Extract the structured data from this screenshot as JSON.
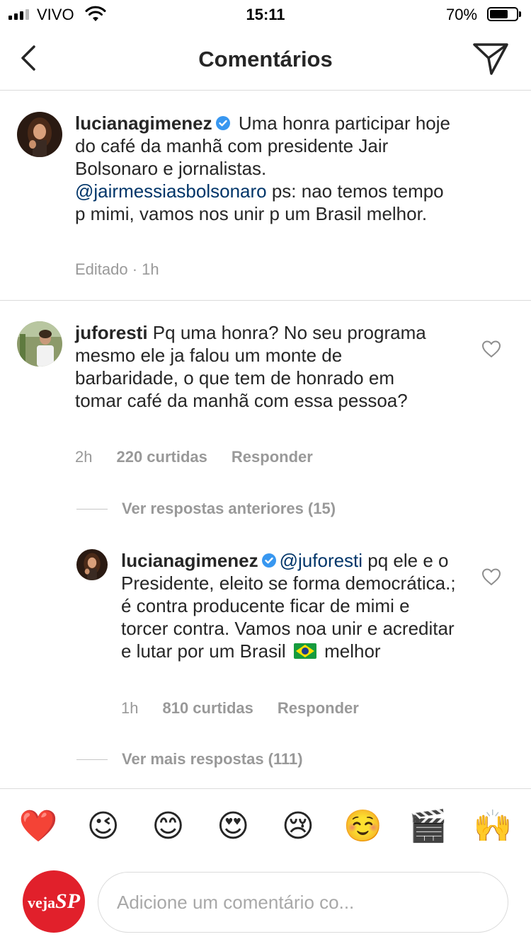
{
  "status": {
    "carrier": "VIVO",
    "time": "15:11",
    "battery": "70%",
    "battery_level": 0.7
  },
  "nav": {
    "title": "Comentários"
  },
  "caption": {
    "username": "lucianagimenez",
    "text_1": " Uma honra participar hoje do café da manhã com presidente Jair Bolsonaro e jornalistas. ",
    "mention": "@jairmessiasbolsonaro",
    "text_2": " ps: nao temos tempo p mimi, vamos nos unir p um Brasil melhor.",
    "meta": "Editado · 1h"
  },
  "comment": {
    "username": "juforesti",
    "text": " Pq uma honra? No seu programa mesmo ele ja falou um monte de barbaridade, o que tem de honrado em tomar café da manhã com essa pessoa?",
    "time": "2h",
    "likes": "220 curtidas",
    "reply_label": "Responder",
    "previous_replies": "Ver respostas anteriores (15)"
  },
  "reply": {
    "username": "lucianagimenez",
    "mention": "@juforesti",
    "text_1": " pq ele e o Presidente, eleito se forma democrática.; é contra producente ficar de mimi e torcer contra. Vamos noa unir e acreditar e lutar por um Brasil",
    "text_2": " melhor",
    "time": "1h",
    "likes": "810 curtidas",
    "reply_label": "Responder",
    "more_replies": "Ver mais respostas (111)"
  },
  "emoji_bar": {
    "items": [
      "❤️",
      "😉",
      "😊",
      "😍",
      "😢",
      "☺️",
      "🎬",
      "🙌"
    ]
  },
  "input": {
    "placeholder": "Adicione um comentário co...",
    "avatar_logo_1": "veja",
    "avatar_logo_2": "SP"
  }
}
